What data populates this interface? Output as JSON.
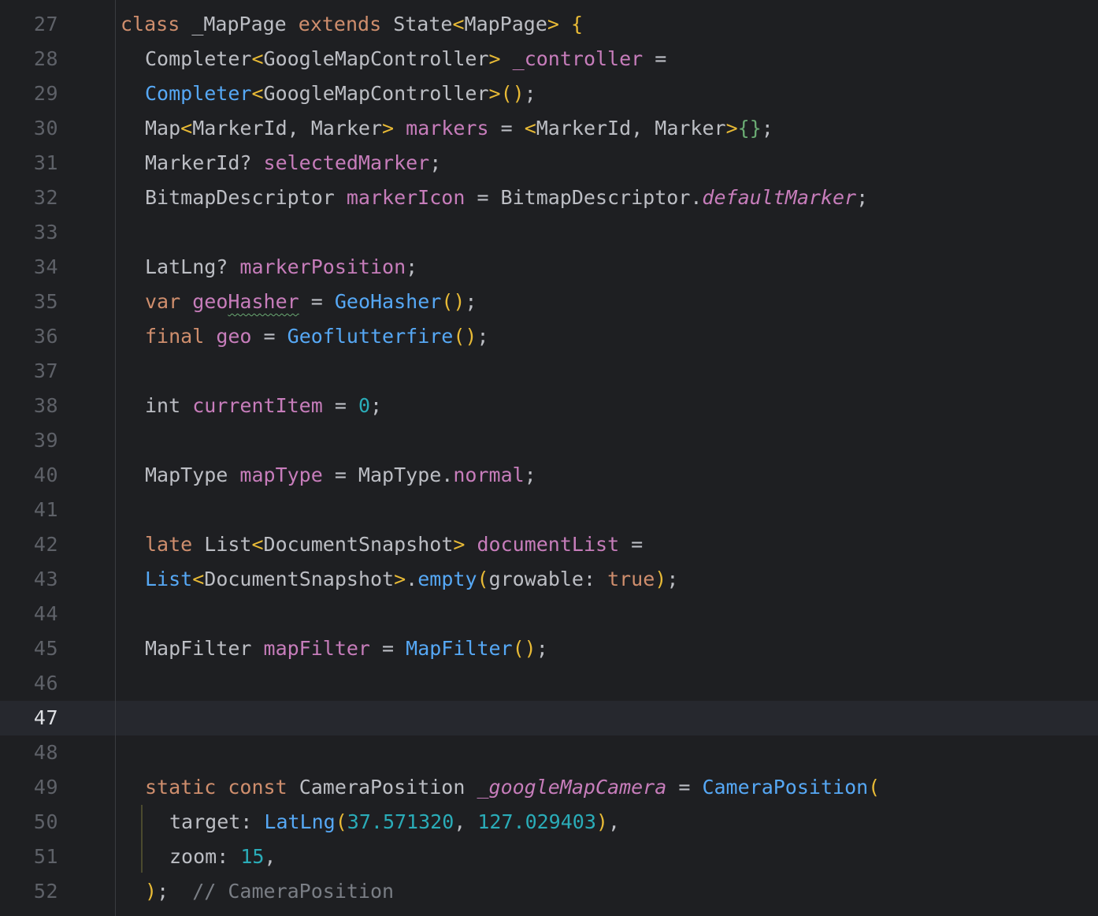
{
  "editor": {
    "colors": {
      "background": "#1e1f22",
      "keyword": "#cf8e6d",
      "field": "#c77dbb",
      "function": "#56a8f5",
      "number": "#2aacb8",
      "bracket": "#e8ba36",
      "comment": "#7a7e85"
    },
    "current_line": "47",
    "lines": [
      {
        "num": "27",
        "indent": 0,
        "tokens": [
          {
            "t": "class",
            "c": "kw"
          },
          {
            "t": " _MapPage ",
            "c": "ty"
          },
          {
            "t": "extends",
            "c": "kw"
          },
          {
            "t": " State",
            "c": "ty"
          },
          {
            "t": "<",
            "c": "par"
          },
          {
            "t": "MapPage",
            "c": "ty"
          },
          {
            "t": "> {",
            "c": "par"
          }
        ]
      },
      {
        "num": "28",
        "indent": 1,
        "tokens": [
          {
            "t": "Completer",
            "c": "ty"
          },
          {
            "t": "<",
            "c": "par"
          },
          {
            "t": "GoogleMapController",
            "c": "ty"
          },
          {
            "t": ">",
            "c": "par"
          },
          {
            "t": " ",
            "c": "ty"
          },
          {
            "t": "_controller",
            "c": "fld"
          },
          {
            "t": " =",
            "c": "ty"
          }
        ]
      },
      {
        "num": "29",
        "indent": 1,
        "tokens": [
          {
            "t": "Completer",
            "c": "fn"
          },
          {
            "t": "<",
            "c": "par"
          },
          {
            "t": "GoogleMapController",
            "c": "ty"
          },
          {
            "t": ">()",
            "c": "par"
          },
          {
            "t": ";",
            "c": "ty"
          }
        ]
      },
      {
        "num": "30",
        "indent": 1,
        "tokens": [
          {
            "t": "Map",
            "c": "ty"
          },
          {
            "t": "<",
            "c": "par"
          },
          {
            "t": "MarkerId, Marker",
            "c": "ty"
          },
          {
            "t": ">",
            "c": "par"
          },
          {
            "t": " ",
            "c": "ty"
          },
          {
            "t": "markers",
            "c": "fld"
          },
          {
            "t": " = ",
            "c": "ty"
          },
          {
            "t": "<",
            "c": "par"
          },
          {
            "t": "MarkerId, Marker",
            "c": "ty"
          },
          {
            "t": ">",
            "c": "par"
          },
          {
            "t": "{}",
            "c": "br2"
          },
          {
            "t": ";",
            "c": "ty"
          }
        ]
      },
      {
        "num": "31",
        "indent": 1,
        "tokens": [
          {
            "t": "MarkerId? ",
            "c": "ty"
          },
          {
            "t": "selectedMarker",
            "c": "fld"
          },
          {
            "t": ";",
            "c": "ty"
          }
        ]
      },
      {
        "num": "32",
        "indent": 1,
        "tokens": [
          {
            "t": "BitmapDescriptor ",
            "c": "ty"
          },
          {
            "t": "markerIcon",
            "c": "fld"
          },
          {
            "t": " = BitmapDescriptor.",
            "c": "ty"
          },
          {
            "t": "defaultMarker",
            "c": "fld it"
          },
          {
            "t": ";",
            "c": "ty"
          }
        ]
      },
      {
        "num": "33",
        "indent": 0,
        "tokens": []
      },
      {
        "num": "34",
        "indent": 1,
        "tokens": [
          {
            "t": "LatLng? ",
            "c": "ty"
          },
          {
            "t": "markerPosition",
            "c": "fld"
          },
          {
            "t": ";",
            "c": "ty"
          }
        ]
      },
      {
        "num": "35",
        "indent": 1,
        "tokens": [
          {
            "t": "var",
            "c": "kw"
          },
          {
            "t": " ",
            "c": "ty"
          },
          {
            "t": "geo",
            "c": "fld"
          },
          {
            "t": "Hasher",
            "c": "fld warn"
          },
          {
            "t": " = ",
            "c": "ty"
          },
          {
            "t": "GeoHasher",
            "c": "fn"
          },
          {
            "t": "()",
            "c": "par"
          },
          {
            "t": ";",
            "c": "ty"
          }
        ]
      },
      {
        "num": "36",
        "indent": 1,
        "tokens": [
          {
            "t": "final",
            "c": "kw"
          },
          {
            "t": " ",
            "c": "ty"
          },
          {
            "t": "geo",
            "c": "fld"
          },
          {
            "t": " = ",
            "c": "ty"
          },
          {
            "t": "Geoflutterfire",
            "c": "fn"
          },
          {
            "t": "()",
            "c": "par"
          },
          {
            "t": ";",
            "c": "ty"
          }
        ]
      },
      {
        "num": "37",
        "indent": 0,
        "tokens": []
      },
      {
        "num": "38",
        "indent": 1,
        "tokens": [
          {
            "t": "int ",
            "c": "ty"
          },
          {
            "t": "currentItem",
            "c": "fld"
          },
          {
            "t": " = ",
            "c": "ty"
          },
          {
            "t": "0",
            "c": "num"
          },
          {
            "t": ";",
            "c": "ty"
          }
        ]
      },
      {
        "num": "39",
        "indent": 0,
        "tokens": []
      },
      {
        "num": "40",
        "indent": 1,
        "tokens": [
          {
            "t": "MapType ",
            "c": "ty"
          },
          {
            "t": "mapType",
            "c": "fld"
          },
          {
            "t": " = MapType.",
            "c": "ty"
          },
          {
            "t": "normal",
            "c": "fld"
          },
          {
            "t": ";",
            "c": "ty"
          }
        ]
      },
      {
        "num": "41",
        "indent": 0,
        "tokens": []
      },
      {
        "num": "42",
        "indent": 1,
        "tokens": [
          {
            "t": "late",
            "c": "kw"
          },
          {
            "t": " List",
            "c": "ty"
          },
          {
            "t": "<",
            "c": "par"
          },
          {
            "t": "DocumentSnapshot",
            "c": "ty"
          },
          {
            "t": ">",
            "c": "par"
          },
          {
            "t": " ",
            "c": "ty"
          },
          {
            "t": "documentList",
            "c": "fld"
          },
          {
            "t": " =",
            "c": "ty"
          }
        ]
      },
      {
        "num": "43",
        "indent": 1,
        "tokens": [
          {
            "t": "List",
            "c": "fn"
          },
          {
            "t": "<",
            "c": "par"
          },
          {
            "t": "DocumentSnapshot",
            "c": "ty"
          },
          {
            "t": ">",
            "c": "par"
          },
          {
            "t": ".",
            "c": "ty"
          },
          {
            "t": "empty",
            "c": "fn"
          },
          {
            "t": "(",
            "c": "par"
          },
          {
            "t": "growable: ",
            "c": "ty"
          },
          {
            "t": "true",
            "c": "kw"
          },
          {
            "t": ")",
            "c": "par"
          },
          {
            "t": ";",
            "c": "ty"
          }
        ]
      },
      {
        "num": "44",
        "indent": 0,
        "tokens": []
      },
      {
        "num": "45",
        "indent": 1,
        "tokens": [
          {
            "t": "MapFilter ",
            "c": "ty"
          },
          {
            "t": "mapFilter",
            "c": "fld"
          },
          {
            "t": " = ",
            "c": "ty"
          },
          {
            "t": "MapFilter",
            "c": "fn"
          },
          {
            "t": "()",
            "c": "par"
          },
          {
            "t": ";",
            "c": "ty"
          }
        ]
      },
      {
        "num": "46",
        "indent": 0,
        "tokens": []
      },
      {
        "num": "47",
        "indent": 0,
        "tokens": []
      },
      {
        "num": "48",
        "indent": 0,
        "tokens": []
      },
      {
        "num": "49",
        "indent": 1,
        "tokens": [
          {
            "t": "static",
            "c": "kw"
          },
          {
            "t": " ",
            "c": "ty"
          },
          {
            "t": "const",
            "c": "kw"
          },
          {
            "t": " CameraPosition ",
            "c": "ty"
          },
          {
            "t": "_googleMapCamera",
            "c": "fld it"
          },
          {
            "t": " = ",
            "c": "ty"
          },
          {
            "t": "CameraPosition",
            "c": "fn"
          },
          {
            "t": "(",
            "c": "par"
          }
        ]
      },
      {
        "num": "50",
        "indent": 2,
        "tokens": [
          {
            "t": "target: ",
            "c": "ty"
          },
          {
            "t": "LatLng",
            "c": "fn"
          },
          {
            "t": "(",
            "c": "par"
          },
          {
            "t": "37.571320",
            "c": "num"
          },
          {
            "t": ", ",
            "c": "ty"
          },
          {
            "t": "127.029403",
            "c": "num"
          },
          {
            "t": ")",
            "c": "par"
          },
          {
            "t": ",",
            "c": "ty"
          }
        ]
      },
      {
        "num": "51",
        "indent": 2,
        "tokens": [
          {
            "t": "zoom: ",
            "c": "ty"
          },
          {
            "t": "15",
            "c": "num"
          },
          {
            "t": ",",
            "c": "ty"
          }
        ]
      },
      {
        "num": "52",
        "indent": 1,
        "tokens": [
          {
            "t": ")",
            "c": "par"
          },
          {
            "t": ";  ",
            "c": "ty"
          },
          {
            "t": "// CameraPosition",
            "c": "cmt"
          }
        ]
      }
    ]
  }
}
